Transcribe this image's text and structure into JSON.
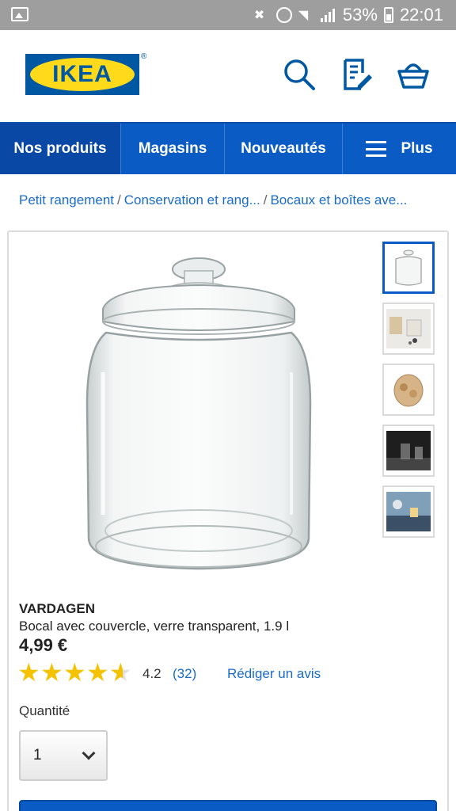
{
  "status_bar": {
    "battery": "53%",
    "time": "22:01"
  },
  "header": {
    "logo_text": "IKEA",
    "registered_mark": "®",
    "icons": [
      "search-icon",
      "shopping-list-icon",
      "shopping-basket-icon"
    ]
  },
  "nav": {
    "items": [
      {
        "label": "Nos produits"
      },
      {
        "label": "Magasins"
      },
      {
        "label": "Nouveautés"
      },
      {
        "label": "Plus"
      }
    ]
  },
  "breadcrumb": {
    "items": [
      "Petit rangement",
      "Conservation et rang...",
      "Bocaux et boîtes ave..."
    ],
    "separator": "/"
  },
  "product": {
    "name": "VARDAGEN",
    "description": "Bocal avec couvercle, verre transparent, 1.9 l",
    "price": "4,99 €",
    "rating_value": "4.2",
    "rating_fraction": 0.84,
    "review_count": "(32)",
    "write_review": "Rédiger un avis",
    "quantity_label": "Quantité",
    "quantity_value": "1",
    "thumbnails": [
      "jar",
      "jar-kitchen",
      "jar-cookies",
      "jar-dark",
      "jar-table"
    ]
  },
  "colors": {
    "brand_blue": "#0058a3",
    "brand_yellow": "#ffda1a",
    "nav_blue": "#0a5cc4",
    "link_blue": "#1a6cc8",
    "star": "#f5c200"
  }
}
